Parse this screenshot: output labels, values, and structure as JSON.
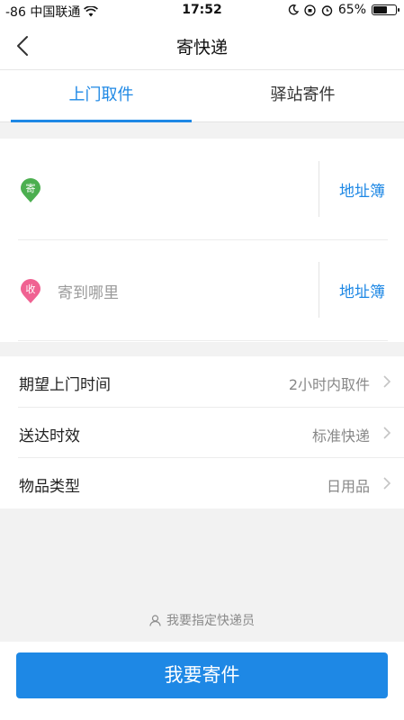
{
  "status_bar": {
    "carrier": "-86 中国联通",
    "time": "17:52",
    "battery": "65%",
    "battery_level": 0.65
  },
  "header": {
    "title": "寄快递",
    "back_icon": "chevron-left-icon"
  },
  "tabs": [
    {
      "label": "上门取件",
      "active": true
    },
    {
      "label": "驿站寄件",
      "active": false
    }
  ],
  "address": {
    "sender": {
      "badge": "寄",
      "placeholder": "",
      "book_label": "地址簿",
      "badge_color": "#4caf50"
    },
    "receiver": {
      "badge": "收",
      "placeholder": "寄到哪里",
      "book_label": "地址簿",
      "badge_color": "#f06292"
    }
  },
  "options": [
    {
      "label": "期望上门时间",
      "value": "2小时内取件"
    },
    {
      "label": "送达时效",
      "value": "标准快递"
    },
    {
      "label": "物品类型",
      "value": "日用品"
    }
  ],
  "courier_link": "我要指定快递员",
  "submit_label": "我要寄件",
  "colors": {
    "accent": "#1e88e5",
    "background": "#f2f2f2"
  }
}
